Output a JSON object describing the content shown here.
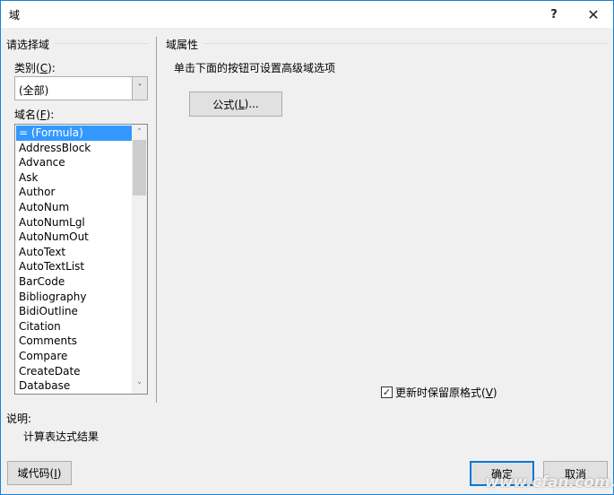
{
  "window": {
    "title": "域",
    "help_label": "?",
    "close_label": "✕"
  },
  "left_panel": {
    "group_title": "请选择域",
    "category_label": "类别(",
    "category_accel": "C",
    "category_label_end": "):",
    "category_value": "(全部)",
    "field_name_label": "域名(",
    "field_name_accel": "F",
    "field_name_label_end": "):",
    "field_names": [
      "= (Formula)",
      "AddressBlock",
      "Advance",
      "Ask",
      "Author",
      "AutoNum",
      "AutoNumLgl",
      "AutoNumOut",
      "AutoText",
      "AutoTextList",
      "BarCode",
      "Bibliography",
      "BidiOutline",
      "Citation",
      "Comments",
      "Compare",
      "CreateDate",
      "Database"
    ],
    "selected_index": 0,
    "scroll_up_icon": "˄",
    "scroll_down_icon": "˅",
    "combo_arrow_icon": "˅"
  },
  "description": {
    "label": "说明:",
    "text": "计算表达式结果"
  },
  "right_panel": {
    "group_title": "域属性",
    "instruction": "单击下面的按钮可设置高级域选项",
    "formula_button": {
      "label_pre": "公式(",
      "accel": "L",
      "label_post": ")..."
    },
    "preserve_format": {
      "checked": true,
      "check_glyph": "✓",
      "label_pre": "更新时保留原格式(",
      "accel": "V",
      "label_post": ")"
    }
  },
  "footer": {
    "field_codes_button": {
      "label_pre": "域代码(",
      "accel": "I",
      "label_post": ")"
    },
    "ok_label": "确定",
    "cancel_label": "取消"
  },
  "watermark": "www.cfan.com.cn"
}
